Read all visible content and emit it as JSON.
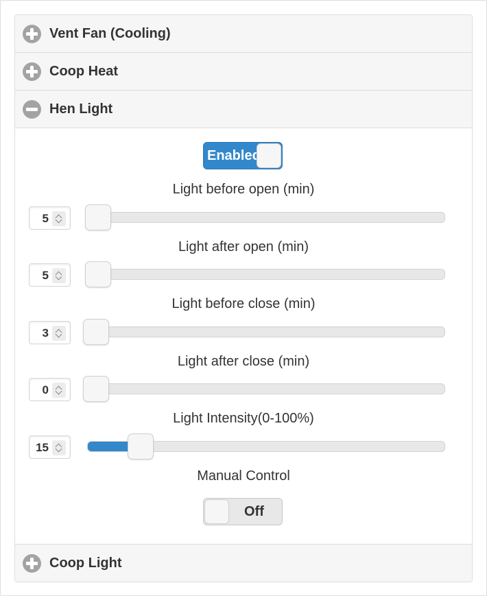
{
  "sections": {
    "vent_fan": {
      "title": "Vent Fan (Cooling)",
      "expanded": false
    },
    "coop_heat": {
      "title": "Coop Heat",
      "expanded": false
    },
    "hen_light": {
      "title": "Hen Light",
      "expanded": true
    },
    "coop_light": {
      "title": "Coop Light",
      "expanded": false
    }
  },
  "hen_light": {
    "enabled_toggle": {
      "label": "Enabled",
      "state": "on"
    },
    "sliders": [
      {
        "label": "Light before open (min)",
        "value": "5",
        "level_percent": 3
      },
      {
        "label": "Light after open (min)",
        "value": "5",
        "level_percent": 3
      },
      {
        "label": "Light before close (min)",
        "value": "3",
        "level_percent": 2
      },
      {
        "label": "Light after close (min)",
        "value": "0",
        "level_percent": 0
      },
      {
        "label": "Light Intensity(0-100%)",
        "value": "15",
        "level_percent": 15
      }
    ],
    "manual_control": {
      "label": "Manual Control",
      "toggle_label": "Off",
      "state": "off"
    }
  },
  "icons": {
    "collapsed": "plus-circle-icon",
    "expanded": "minus-circle-icon",
    "spinner": "spinner-arrows-icon"
  },
  "colors": {
    "accent": "#3388cc",
    "header_bg": "#f6f6f6",
    "icon_gray": "#a3a3a3",
    "track_bg": "#e8e8e8"
  }
}
